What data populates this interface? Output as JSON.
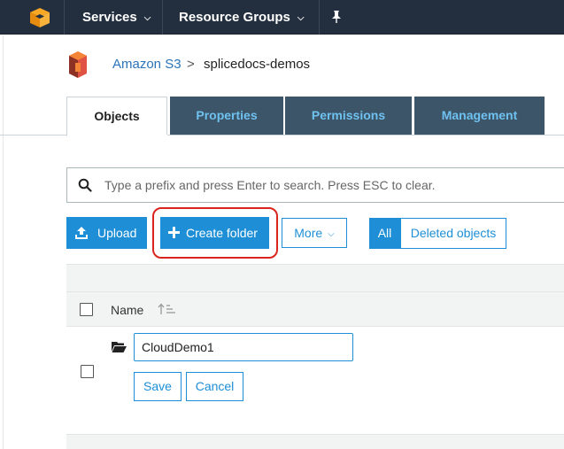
{
  "topnav": {
    "logo_icon": "aws-cube-icon",
    "services_label": "Services",
    "resource_groups_label": "Resource Groups",
    "pin_icon": "pushpin-icon",
    "background": "#232f3e"
  },
  "breadcrumb": {
    "logo_icon": "s3-bucket-icon",
    "root_label": "Amazon S3",
    "separator": ">",
    "current_label": "splicedocs-demos"
  },
  "tabs": [
    {
      "label": "Objects",
      "active": true
    },
    {
      "label": "Properties",
      "active": false
    },
    {
      "label": "Permissions",
      "active": false
    },
    {
      "label": "Management",
      "active": false
    }
  ],
  "search": {
    "icon": "search-icon",
    "placeholder": "Type a prefix and press Enter to search. Press ESC to clear.",
    "value": ""
  },
  "actions": {
    "upload_label": "Upload",
    "upload_icon": "upload-icon",
    "create_folder_label": "Create folder",
    "create_folder_icon": "plus-icon",
    "more_label": "More",
    "more_icon": "chevron-down-icon",
    "filter_all_label": "All",
    "filter_deleted_label": "Deleted objects",
    "accent_color": "#1e8fd6",
    "highlight_color": "#d9251c"
  },
  "table": {
    "header_name": "Name",
    "sort_icon": "sort-ascending-icon",
    "new_folder_row": {
      "icon": "folder-open-icon",
      "input_value": "CloudDemo1",
      "save_label": "Save",
      "cancel_label": "Cancel"
    }
  }
}
